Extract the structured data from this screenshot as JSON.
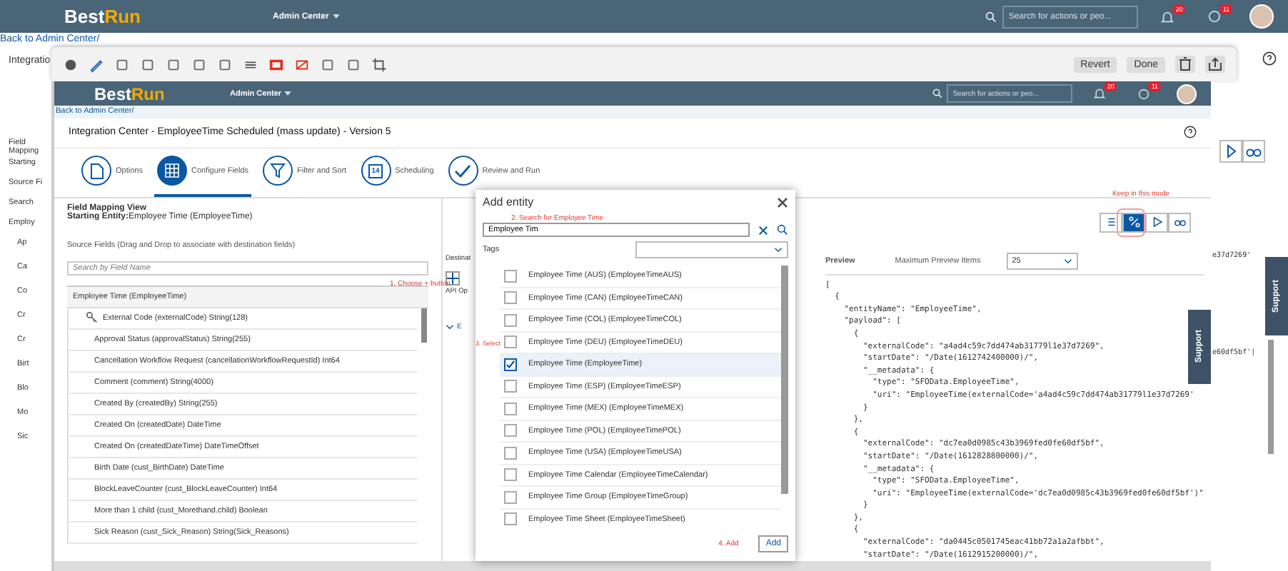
{
  "header": {
    "logo_left": "Best",
    "logo_right": "Run",
    "menu": "Admin Center",
    "search_placeholder": "Search for actions or peo...",
    "notifications": "20",
    "alerts": "11"
  },
  "back_link": "Back to Admin Center/",
  "outer_page": {
    "title": "Integratio",
    "fragments": [
      "Field Mapping",
      "Starting",
      "Source Fi",
      "Search",
      "Employ"
    ],
    "rows": [
      "Ap",
      "Ca",
      "Co",
      "Cr",
      "Cr",
      "Birt",
      "Blo",
      "Mo",
      "Sic"
    ],
    "json_fragments": [
      "e37d7269'",
      "e60df5bf'|"
    ],
    "support": "Support"
  },
  "toolbar": {
    "buttons": [
      "Revert",
      "Done"
    ]
  },
  "inner": {
    "header": {
      "logo_left": "Best",
      "logo_right": "Run",
      "menu": "Admin Center",
      "search_placeholder": "Search for actions or peo...",
      "notifications": "20",
      "alerts": "11"
    },
    "back_link": "Back to Admin Center/",
    "title": "Integration Center - EmployeeTime Scheduled (mass update) - Version 5",
    "steps": [
      {
        "label": "Options",
        "kind": "document",
        "selected": false
      },
      {
        "label": "Configure Fields",
        "kind": "grid",
        "selected": true
      },
      {
        "label": "Filter and Sort",
        "kind": "filter",
        "selected": false
      },
      {
        "label": "Scheduling",
        "kind": "calendar",
        "badge": "14",
        "selected": false
      },
      {
        "label": "Review and Run",
        "kind": "check",
        "selected": false
      }
    ],
    "view_heading": "Field Mapping View",
    "starting_label": "Starting Entity:",
    "starting_value": "Employee Time (EmployeeTime)",
    "source_heading": "Source Fields (Drag and Drop to associate with destination fields)",
    "search_placeholder": "Search by Field Name",
    "hint_choose": "1. Choose + button",
    "destination_heading": "Destinat",
    "api_label": "API Op",
    "dest_row": "E",
    "tree_root": "Employee Time (EmployeeTime)",
    "fields": [
      {
        "label": "External Code (externalCode) String(128)",
        "key": true
      },
      {
        "label": "Approval Status (approvalStatus) String(255)",
        "key": false
      },
      {
        "label": "Cancellation Workflow Request (cancellationWorkflowRequestId) Int64",
        "key": false
      },
      {
        "label": "Comment (comment) String(4000)",
        "key": false
      },
      {
        "label": "Created By (createdBy) String(255)",
        "key": false
      },
      {
        "label": "Created On (createdDate) DateTime",
        "key": false
      },
      {
        "label": "Created On (createdDateTime) DateTimeOffset",
        "key": false
      },
      {
        "label": "Birth Date (cust_BirthDate) DateTime",
        "key": false
      },
      {
        "label": "BlockLeaveCounter (cust_BlockLeaveCounter) Int64",
        "key": false
      },
      {
        "label": "More than 1 child (cust_Morethand.child) Boolean",
        "key": false
      },
      {
        "label": "Sick Reason (cust_Sick_Reason) String(Sick_Reasons)",
        "key": false
      }
    ],
    "keep_hint": "Keep in this mode",
    "view_modes": [
      {
        "kind": "list",
        "selected": false
      },
      {
        "kind": "mapping",
        "selected": true
      },
      {
        "kind": "run",
        "selected": false
      },
      {
        "kind": "preview",
        "selected": false
      }
    ],
    "preview": {
      "title": "Preview",
      "max_label": "Maximum Preview Items",
      "max_value": "25",
      "lines": [
        "[",
        "  {",
        "    \"entityName\": \"EmployeeTime\",",
        "    \"payload\": [",
        "      {",
        "        \"externalCode\": \"a4ad4c59c7dd474ab31779l1e37d7269\",",
        "        \"startDate\": \"/Date(1612742400000)/\",",
        "        \"__metadata\": {",
        "          \"type\": \"SFOData.EmployeeTime\",",
        "          \"uri\": \"EmployeeTime(externalCode='a4ad4c59c7dd474ab31779l1e37d7269'",
        "        }",
        "      },",
        "      {",
        "        \"externalCode\": \"dc7ea0d0985c43b3969fed0fe60df5bf\",",
        "        \"startDate\": \"/Date(1612828800000)/\",",
        "        \"__metadata\": {",
        "          \"type\": \"SFOData.EmployeeTime\",",
        "          \"uri\": \"EmployeeTime(externalCode='dc7ea0d0985c43b3969fed0fe60df5bf')\"",
        "        }",
        "      },",
        "      {",
        "        \"externalCode\": \"da0445c0501745eac41bb72a1a2afbbt\",",
        "        \"startDate\": \"/Date(1612915200000)/\","
      ]
    },
    "support": "Support"
  },
  "dialog": {
    "title": "Add entity",
    "hint_search": "2. Search for Employee Time",
    "search_value": "Employee Tim",
    "tags_label": "Tags",
    "hint_select": "3. Select",
    "items": [
      {
        "label": "Employee Time (AUS) (EmployeeTimeAUS)",
        "checked": false
      },
      {
        "label": "Employee Time (CAN) (EmployeeTimeCAN)",
        "checked": false
      },
      {
        "label": "Employee Time (COL) (EmployeeTimeCOL)",
        "checked": false
      },
      {
        "label": "Employee Time (DEU) (EmployeeTimeDEU)",
        "checked": false
      },
      {
        "label": "Employee Time (EmployeeTime)",
        "checked": true
      },
      {
        "label": "Employee Time (ESP) (EmployeeTimeESP)",
        "checked": false
      },
      {
        "label": "Employee Time (MEX) (EmployeeTimeMEX)",
        "checked": false
      },
      {
        "label": "Employee Time (POL) (EmployeeTimePOL)",
        "checked": false
      },
      {
        "label": "Employee Time (USA) (EmployeeTimeUSA)",
        "checked": false
      },
      {
        "label": "Employee Time Calendar (EmployeeTimeCalendar)",
        "checked": false
      },
      {
        "label": "Employee Time Group (EmployeeTimeGroup)",
        "checked": false
      },
      {
        "label": "Employee Time Sheet (EmployeeTimeSheet)",
        "checked": false
      }
    ],
    "hint_add": "4. Add",
    "add_button": "Add"
  }
}
